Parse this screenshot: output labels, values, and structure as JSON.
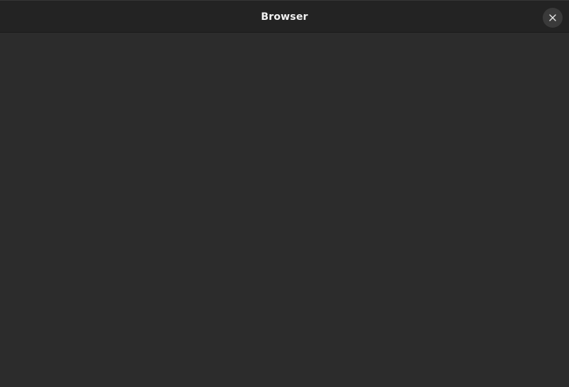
{
  "window": {
    "title": "Browser"
  },
  "icons": {
    "close": "close-icon"
  },
  "colors": {
    "titlebar": "#232323",
    "content": "#2c2c2c",
    "title_text": "#f2f2f2",
    "close_button": "#3a3a3a"
  }
}
